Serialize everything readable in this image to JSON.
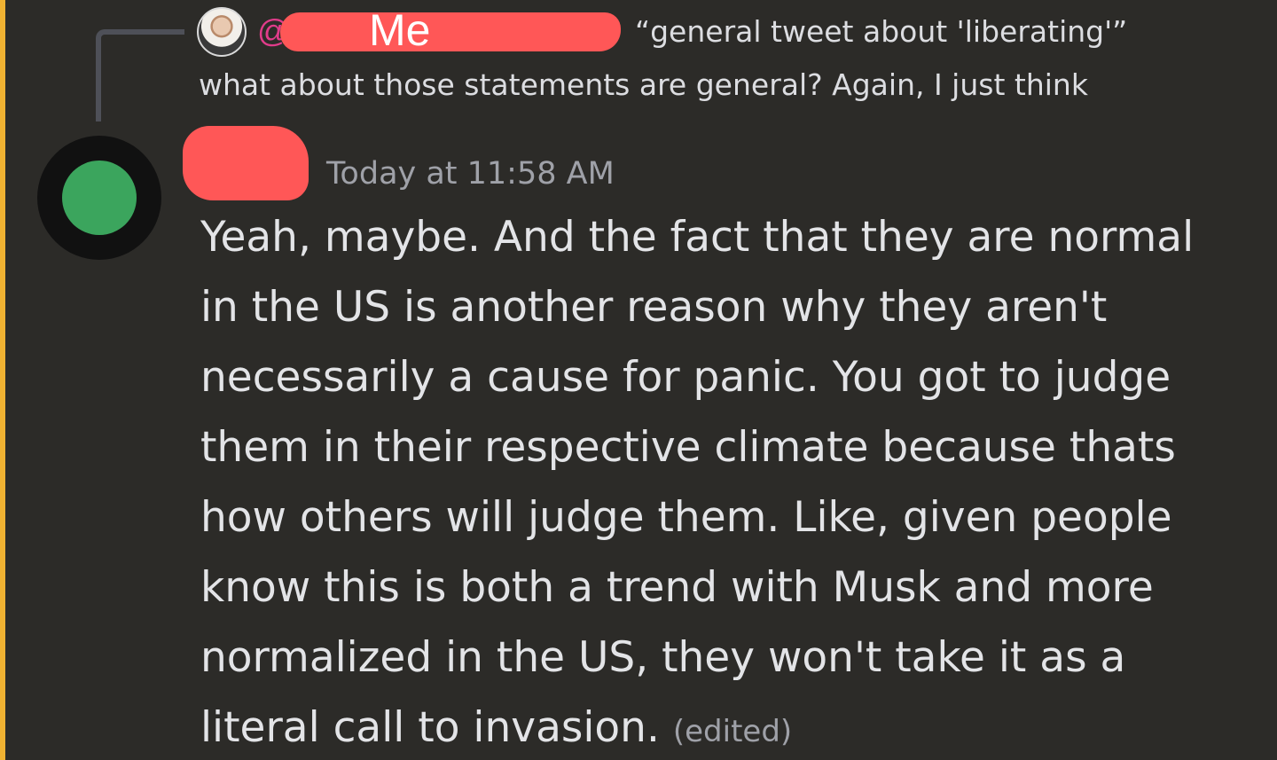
{
  "reply": {
    "at_symbol": "@",
    "author_name": "Me",
    "quoted_text": "“general tweet about 'liberating'”",
    "snippet": "what about those statements are general?  Again, I just think"
  },
  "message": {
    "timestamp": "Today at 11:58 AM",
    "lines": [
      "Yeah, maybe. And the fact that they are normal",
      "in the US is another reason why they aren't",
      "necessarily a cause for panic. You got to judge",
      "them in their respective climate because thats",
      "how others will judge them. Like, given people",
      "know this is both a trend with Musk and more",
      "normalized in the US, they won't take it as a",
      "literal call to invasion."
    ],
    "edited_label": "(edited)"
  },
  "colors": {
    "background": "#2c2b28",
    "accent_bar": "#f0b232",
    "redaction": "#ff5757",
    "mention": "#e03c8a",
    "status_online": "#3ba55d",
    "text_primary": "#e3e4e7",
    "text_muted": "#9fa1a8"
  },
  "icons": {
    "reply_avatar": "user-photo-avatar",
    "main_avatar": "online-status-avatar"
  }
}
